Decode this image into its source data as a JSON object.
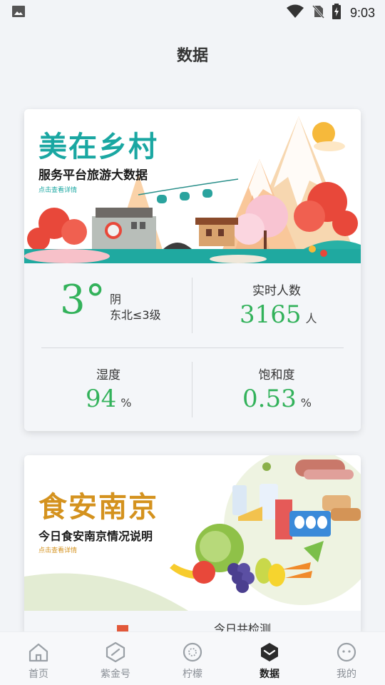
{
  "status_bar": {
    "time": "9:03"
  },
  "page": {
    "title": "数据"
  },
  "tourism_card": {
    "banner_title": "美在乡村",
    "banner_subtitle": "服务平台旅游大数据",
    "banner_link": "点击查看详情",
    "temperature": "3°",
    "weather_condition": "阴",
    "wind": "东北≤3级",
    "visitors_label": "实时人数",
    "visitors_value": "3165",
    "visitors_unit": "人",
    "humidity_label": "湿度",
    "humidity_value": "94",
    "humidity_unit": "%",
    "saturation_label": "饱和度",
    "saturation_value": "0.53",
    "saturation_unit": "%"
  },
  "food_card": {
    "banner_title": "食安南京",
    "banner_subtitle": "今日食安南京情况说明",
    "banner_link": "点击查看详情",
    "detection_label": "今日共检测"
  },
  "tabbar": {
    "tabs": [
      {
        "label": "首页",
        "icon": "home-icon",
        "active": false
      },
      {
        "label": "紫金号",
        "icon": "hexagon-icon",
        "active": false
      },
      {
        "label": "柠檬",
        "icon": "lemon-icon",
        "active": false
      },
      {
        "label": "数据",
        "icon": "data-cube-icon",
        "active": true
      },
      {
        "label": "我的",
        "icon": "face-icon",
        "active": false
      }
    ]
  },
  "colors": {
    "accent_green": "#33b25b",
    "tourism_title": "#1aa7a2",
    "food_title": "#d4921e",
    "active_tab": "#1e1e1e",
    "inactive_tab": "#8a8f96"
  }
}
